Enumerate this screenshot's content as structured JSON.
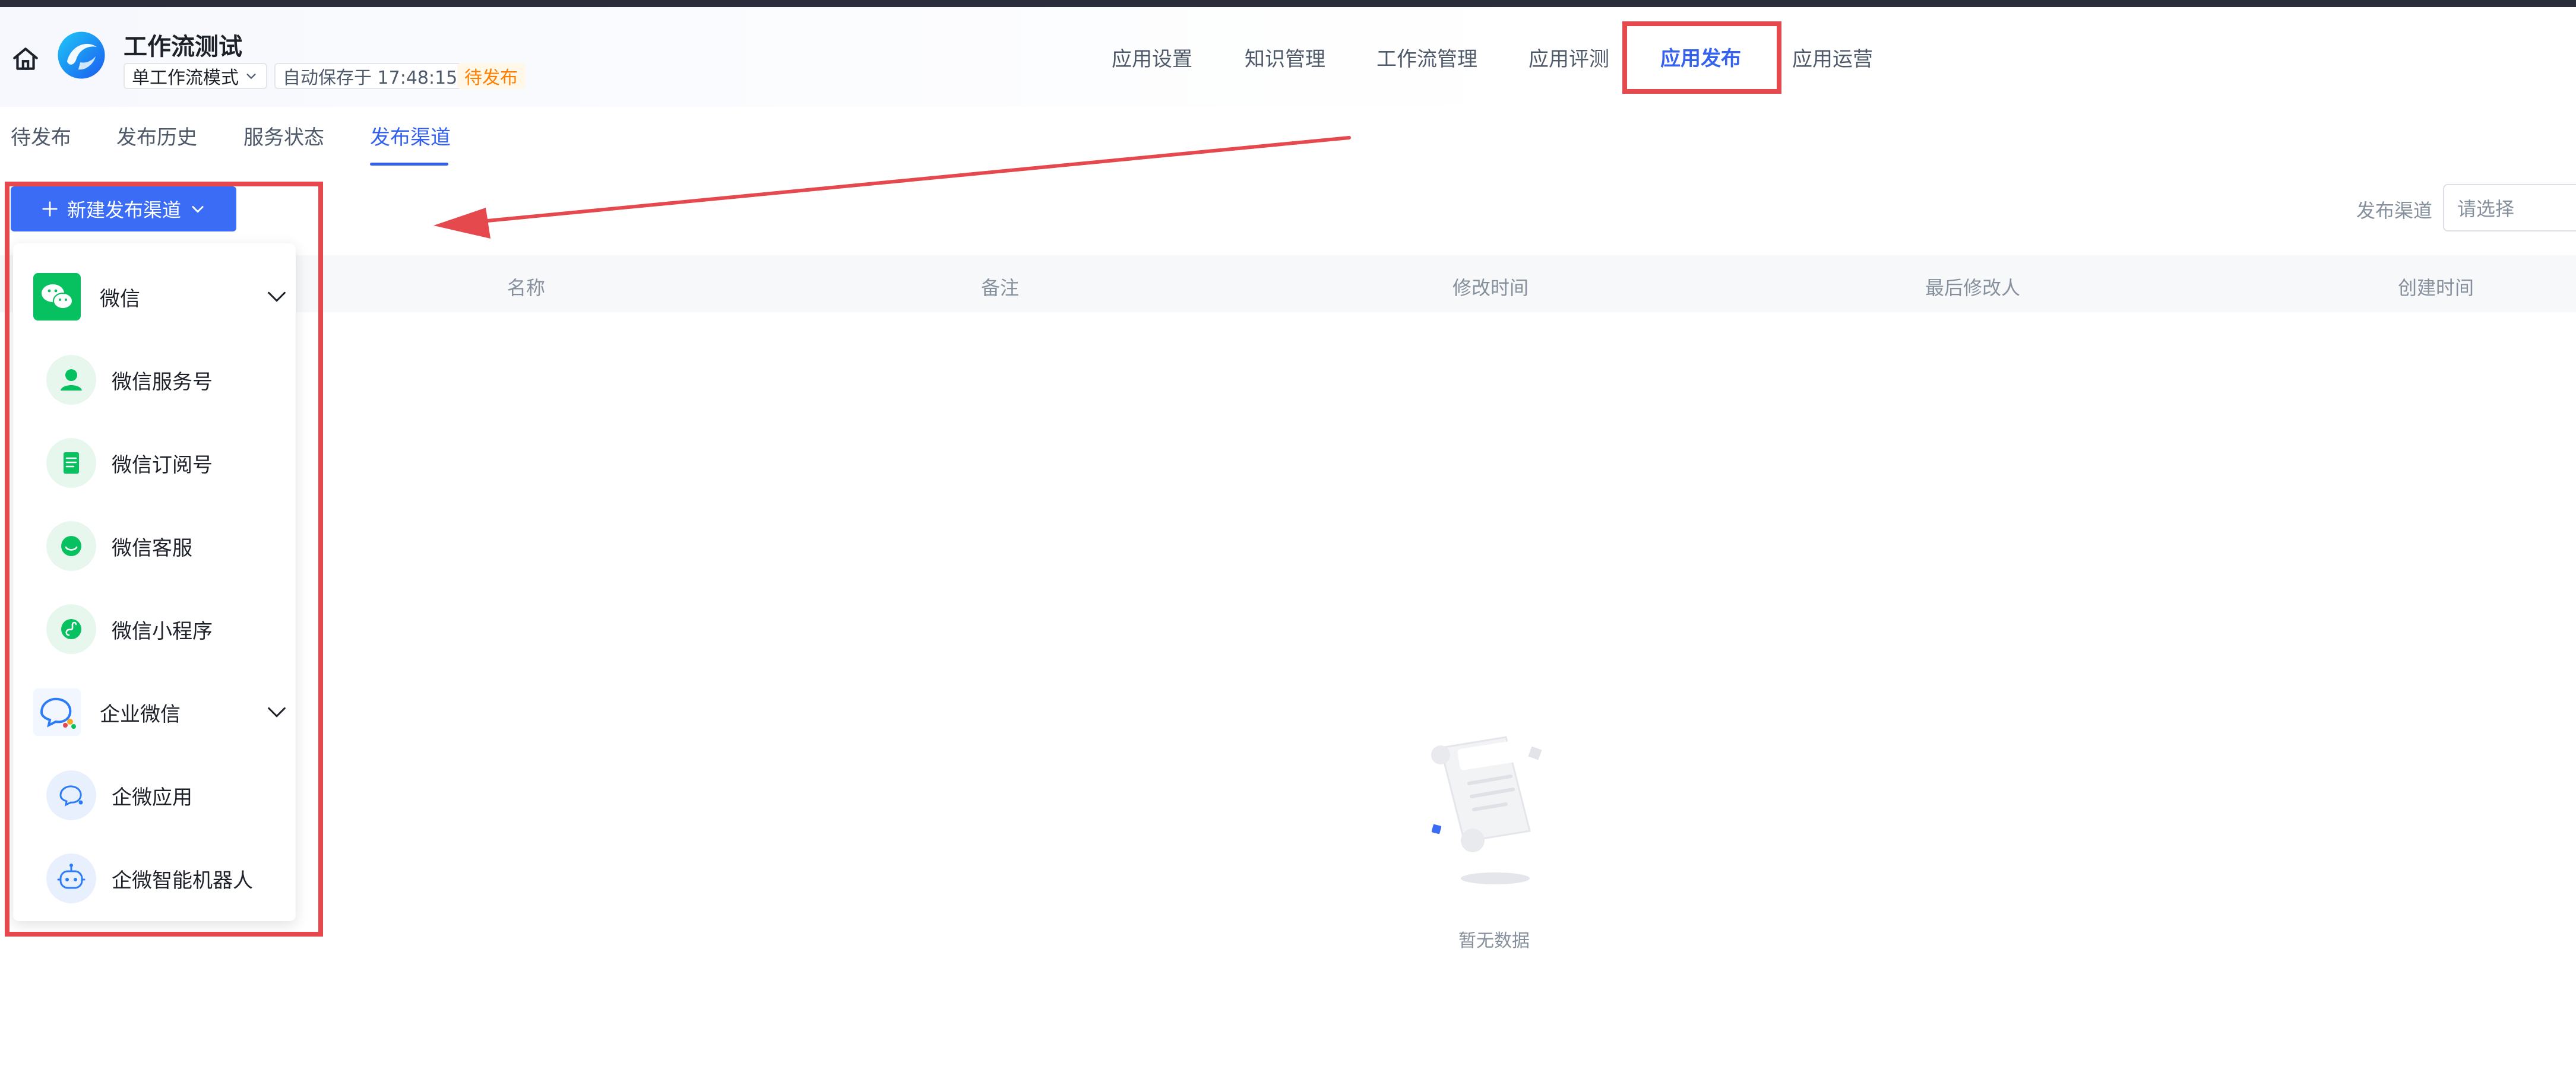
{
  "header": {
    "app_title": "工作流测试",
    "mode_select": "单工作流模式",
    "autosave": "自动保存于 17:48:15",
    "status_badge": "待发布",
    "nav_tabs": [
      "应用设置",
      "知识管理",
      "工作流管理",
      "应用评测",
      "应用发布",
      "应用运营"
    ],
    "active_nav": "应用发布"
  },
  "subtabs": [
    "待发布",
    "发布历史",
    "服务状态",
    "发布渠道"
  ],
  "active_subtab": "发布渠道",
  "toolbar": {
    "new_channel_label": "新建发布渠道",
    "filter_label": "发布渠道",
    "filter_placeholder": "请选择"
  },
  "table": {
    "columns": [
      "名称",
      "备注",
      "修改时间",
      "最后修改人",
      "创建时间"
    ]
  },
  "empty_text": "暂无数据",
  "dropdown": {
    "groups": [
      {
        "label": "微信",
        "items": [
          "微信服务号",
          "微信订阅号",
          "微信客服",
          "微信小程序"
        ]
      },
      {
        "label": "企业微信",
        "items": [
          "企微应用",
          "企微智能机器人"
        ]
      }
    ]
  },
  "colors": {
    "accent": "#3462ef",
    "primary_button": "#3b6cf6",
    "wechat_green": "#07c160",
    "wecom_blue": "#2b7cf6",
    "annotation_red": "#e5484d",
    "pending_orange": "#ff7d00"
  },
  "icons": {
    "home": "home-icon",
    "logo": "app-logo-icon",
    "wechat": "wechat-icon",
    "wecom": "wecom-icon"
  }
}
